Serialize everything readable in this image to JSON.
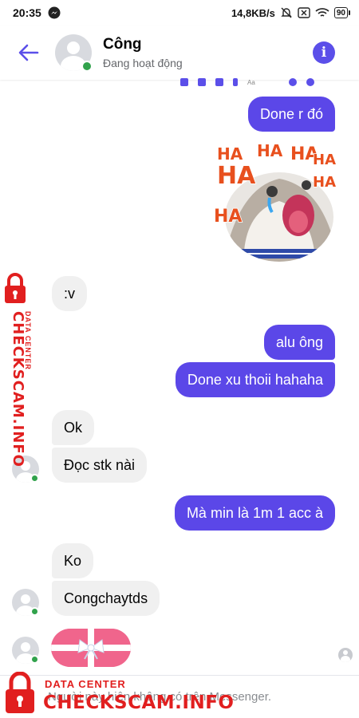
{
  "status_bar": {
    "time": "20:35",
    "network_speed": "14,8KB/s",
    "battery": "90",
    "icons": [
      "messenger-icon",
      "mute-icon",
      "sim-off-icon",
      "wifi-icon",
      "battery-icon"
    ]
  },
  "header": {
    "name": "Công",
    "status": "Đang hoạt động",
    "back_icon": "arrow-left-icon",
    "info_icon": "info-icon",
    "accent_color": "#5b4fe9"
  },
  "mini_toolbar": {
    "aa_label": "Aa"
  },
  "messages": [
    {
      "id": "m1",
      "side": "sent",
      "text": "Done r đó"
    },
    {
      "id": "m2",
      "side": "sent",
      "type": "sticker",
      "sticker_words": [
        "HA",
        "HA",
        "HA",
        "HA",
        "HA",
        "HA",
        "HA"
      ]
    },
    {
      "id": "m3",
      "side": "received",
      "text": ":v"
    },
    {
      "id": "m4",
      "side": "sent",
      "text": "alu ông"
    },
    {
      "id": "m5",
      "side": "sent",
      "text": "Done xu thoii hahaha"
    },
    {
      "id": "m6",
      "side": "received",
      "text": "Ok"
    },
    {
      "id": "m7",
      "side": "received",
      "text": "Đọc stk nài"
    },
    {
      "id": "m8",
      "side": "sent",
      "text": "Mà min là 1m 1 acc à"
    },
    {
      "id": "m9",
      "side": "received",
      "text": "Ko"
    },
    {
      "id": "m10",
      "side": "received",
      "text": "Congchaytds"
    },
    {
      "id": "m11",
      "side": "received",
      "type": "gift-sticker"
    }
  ],
  "footer": {
    "notice": "Người này hiện không có trên Messenger."
  },
  "watermark": {
    "small": "DATA CENTER",
    "large": "CHECKSCAM.INFO"
  },
  "colors": {
    "sent_bubble": "#5b47e8",
    "received_bubble": "#f0f0f0",
    "online": "#31a24c",
    "watermark": "#e11f1f"
  }
}
